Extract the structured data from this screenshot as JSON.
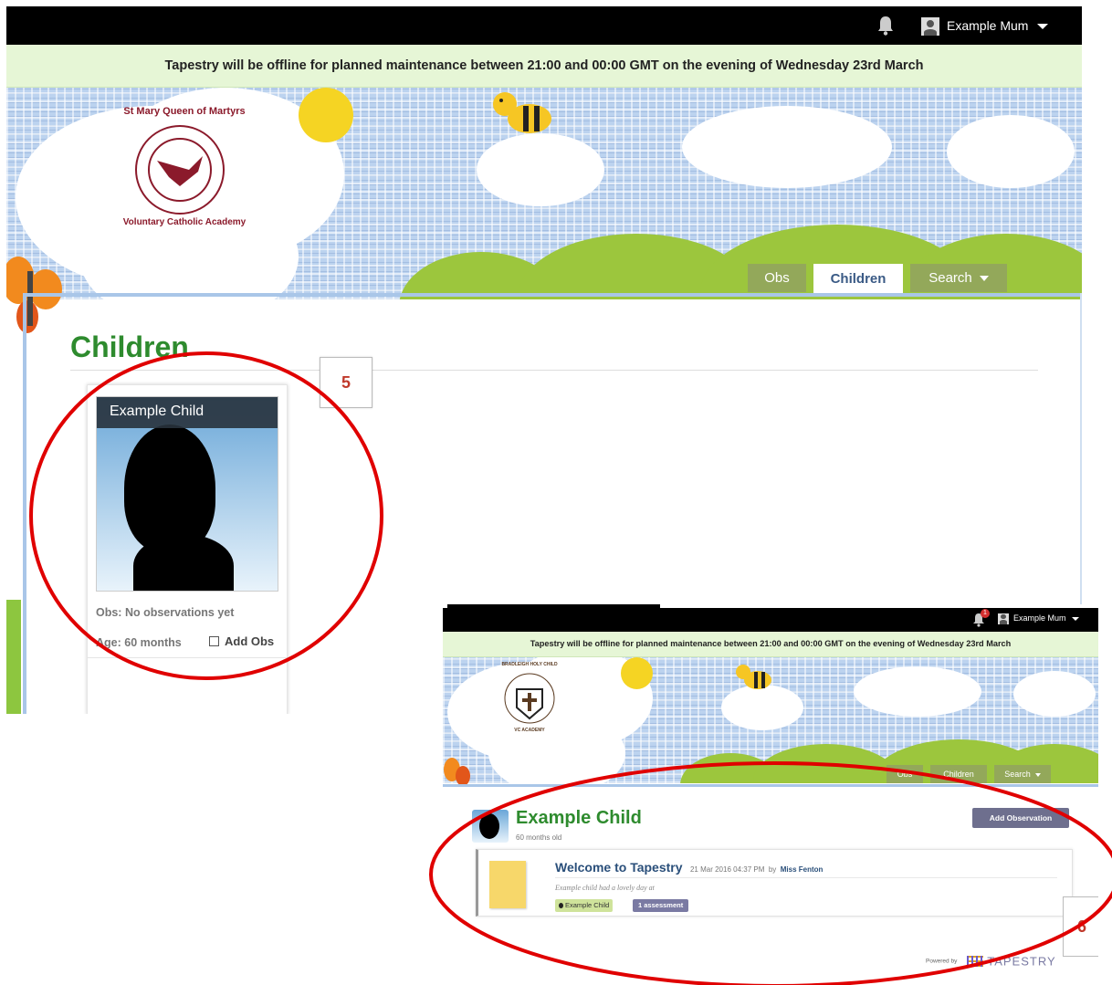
{
  "shot1": {
    "user_name": "Example Mum",
    "banner": "Tapestry will be offline for planned maintenance between 21:00 and 00:00 GMT on the evening of Wednesday 23rd March",
    "logo": {
      "text_top": "St Mary Queen of Martyrs",
      "text_bottom": "Voluntary Catholic Academy",
      "color": "#8b1a2b"
    },
    "tabs": [
      "Obs",
      "Children",
      "Search"
    ],
    "page_title": "Children",
    "card": {
      "name": "Example Child",
      "obs": "Obs: No observations yet",
      "age": "Age: 60 months",
      "add_obs": "Add Obs"
    },
    "callout": "5"
  },
  "shot2": {
    "user_name": "Example Mum",
    "notification_count": "1",
    "banner": "Tapestry will be offline for planned maintenance between 21:00 and 00:00 GMT on the evening of Wednesday 23rd March",
    "logo": {
      "text_top": "BRADLEIGH HOLY CHILD",
      "text_bottom": "VC ACADEMY"
    },
    "tabs": [
      "Obs",
      "Children",
      "Search"
    ],
    "child_name": "Example Child",
    "child_age": "60 months old",
    "add_observation": "Add Observation",
    "observation": {
      "title": "Welcome to Tapestry",
      "date": "21 Mar 2016 04:37 PM",
      "by": "by",
      "author": "Miss Fenton",
      "text": "Example child had a lovely day at",
      "child_tag": "Example Child",
      "assessment_tag": "1 assessment"
    },
    "powered_by": "Powered by",
    "brand": "TAPESTRY",
    "callout": "6"
  },
  "colors": {
    "green_title": "#2e8b2e",
    "blue_text": "#2a4f7a",
    "annotation_red": "#e00000",
    "tab_active": "#3a5a85"
  }
}
